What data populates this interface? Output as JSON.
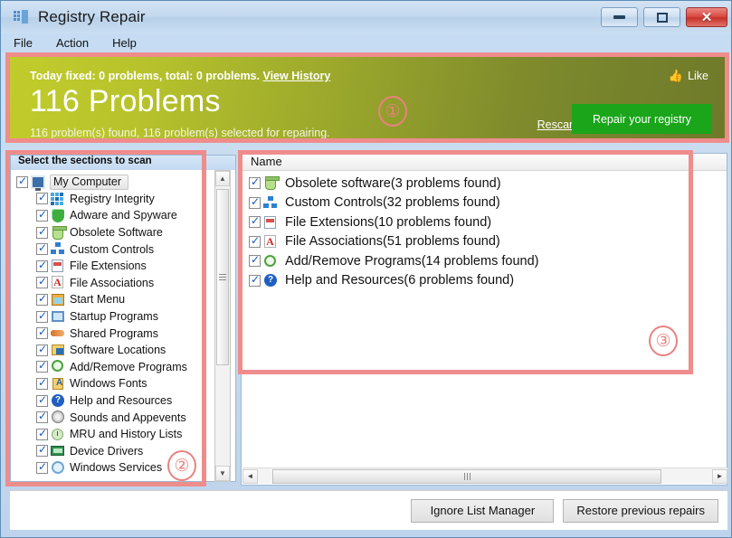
{
  "window": {
    "title": "Registry Repair",
    "app_icon": "registry-app-icon",
    "controls": {
      "minimize": "—",
      "maximize": "□",
      "close": "✕"
    }
  },
  "menu": {
    "items": [
      "File",
      "Action",
      "Help"
    ]
  },
  "banner": {
    "today_prefix": "Today fixed: 0 problems, total: 0 problems.",
    "view_history": "View History",
    "headline": "116 Problems",
    "subtext": "116 problem(s) found, 116 problem(s) selected for repairing.",
    "like_label": "Like",
    "like_icon": "thumbs-up-icon",
    "rescan_label": "Rescan",
    "repair_label": "Repair your registry",
    "accent_green": "#1aa51a",
    "banner_start": "#c1cc2b",
    "banner_end": "#6e7a2a"
  },
  "annotations": [
    {
      "id": "1",
      "label": "①"
    },
    {
      "id": "2",
      "label": "②"
    },
    {
      "id": "3",
      "label": "③"
    }
  ],
  "sidebar": {
    "header": "Select the sections to scan",
    "root": {
      "label": "My Computer",
      "icon": "monitor-icon",
      "checked": true
    },
    "items": [
      {
        "label": "Registry Integrity",
        "icon": "registry-grid-icon",
        "checked": true
      },
      {
        "label": "Adware and Spyware",
        "icon": "shield-icon",
        "checked": true
      },
      {
        "label": "Obsolete Software",
        "icon": "recycle-bin-icon",
        "checked": true
      },
      {
        "label": "Custom Controls",
        "icon": "network-nodes-icon",
        "checked": true
      },
      {
        "label": "File Extensions",
        "icon": "file-extension-icon",
        "checked": true
      },
      {
        "label": "File Associations",
        "icon": "file-association-icon",
        "checked": true
      },
      {
        "label": "Start Menu",
        "icon": "start-menu-icon",
        "checked": true
      },
      {
        "label": "Startup Programs",
        "icon": "startup-window-icon",
        "checked": true
      },
      {
        "label": "Shared Programs",
        "icon": "shared-programs-icon",
        "checked": true
      },
      {
        "label": "Software Locations",
        "icon": "folder-software-icon",
        "checked": true
      },
      {
        "label": "Add/Remove Programs",
        "icon": "add-remove-icon",
        "checked": true
      },
      {
        "label": "Windows Fonts",
        "icon": "fonts-folder-icon",
        "checked": true
      },
      {
        "label": "Help and Resources",
        "icon": "help-question-icon",
        "checked": true
      },
      {
        "label": "Sounds and Appevents",
        "icon": "sound-disc-icon",
        "checked": true
      },
      {
        "label": "MRU and History Lists",
        "icon": "history-clock-icon",
        "checked": true
      },
      {
        "label": "Device Drivers",
        "icon": "device-driver-icon",
        "checked": true
      },
      {
        "label": "Windows Services",
        "icon": "services-search-icon",
        "checked": true
      }
    ],
    "scrollbar": {
      "up_arrow": "▲",
      "down_arrow": "▼"
    }
  },
  "results": {
    "column_header": "Name",
    "rows": [
      {
        "label": "Obsolete software(3 problems found)",
        "icon": "recycle-bin-icon",
        "checked": true,
        "count": 3
      },
      {
        "label": "Custom Controls(32 problems found)",
        "icon": "network-nodes-icon",
        "checked": true,
        "count": 32
      },
      {
        "label": "File Extensions(10 problems found)",
        "icon": "file-extension-icon",
        "checked": true,
        "count": 10
      },
      {
        "label": "File Associations(51 problems found)",
        "icon": "file-association-icon",
        "checked": true,
        "count": 51
      },
      {
        "label": "Add/Remove Programs(14 problems found)",
        "icon": "add-remove-icon",
        "checked": true,
        "count": 14
      },
      {
        "label": "Help and Resources(6 problems found)",
        "icon": "help-question-icon",
        "checked": true,
        "count": 6
      }
    ],
    "hscroll": {
      "left_arrow": "◄",
      "right_arrow": "►"
    }
  },
  "footer": {
    "ignore_list_label": "Ignore List Manager",
    "restore_label": "Restore previous repairs"
  }
}
